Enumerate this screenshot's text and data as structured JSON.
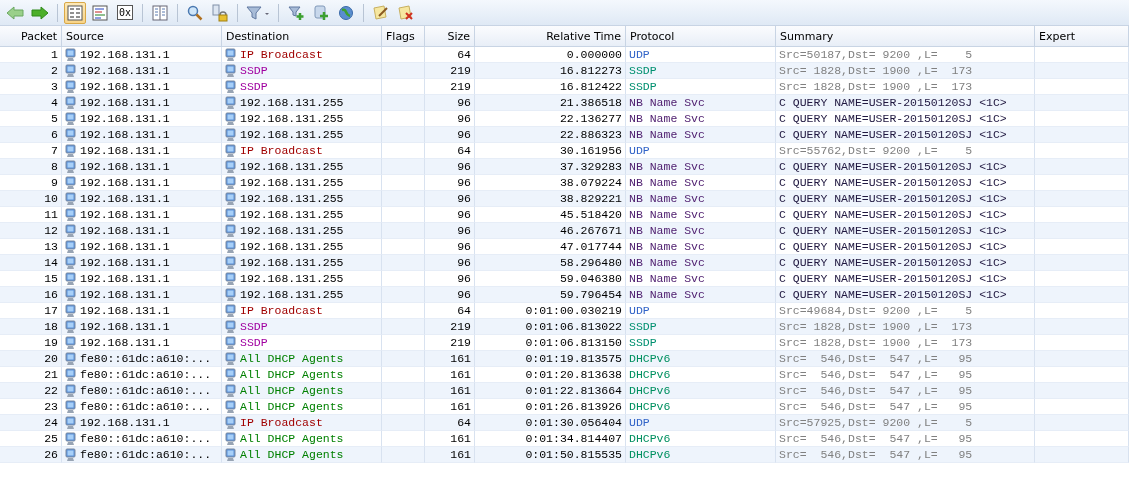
{
  "toolbar": [
    {
      "kind": "back"
    },
    {
      "kind": "forward"
    },
    {
      "kind": "separator"
    },
    {
      "kind": "list-view",
      "selected": true
    },
    {
      "kind": "color-view",
      "selected": false
    },
    {
      "kind": "hex-view",
      "label": "0x",
      "selected": false
    },
    {
      "kind": "separator"
    },
    {
      "kind": "columns"
    },
    {
      "kind": "separator"
    },
    {
      "kind": "search"
    },
    {
      "kind": "lock"
    },
    {
      "kind": "separator"
    },
    {
      "kind": "filter"
    },
    {
      "kind": "separator"
    },
    {
      "kind": "add-filter"
    },
    {
      "kind": "add"
    },
    {
      "kind": "globe"
    },
    {
      "kind": "separator"
    },
    {
      "kind": "edit-note"
    },
    {
      "kind": "delete-note"
    }
  ],
  "table": {
    "columns": [
      "Packet",
      "Source",
      "Destination",
      "Flags",
      "Size",
      "Relative Time",
      "Protocol",
      "Summary",
      "Expert"
    ],
    "rows": [
      {
        "packet": "1",
        "source": "192.168.131.1",
        "destination": {
          "text": "IP Broadcast",
          "color": "#a00000"
        },
        "size": "64",
        "time": "0.000000",
        "protocol": {
          "text": "UDP",
          "color": "#3264c8"
        },
        "summary": {
          "text": "Src=50187,Dst= 9200 ,L=    5",
          "color": "#808080"
        }
      },
      {
        "packet": "2",
        "source": "192.168.131.1",
        "destination": {
          "text": "SSDP",
          "color": "#a000a0"
        },
        "size": "219",
        "time": "16.812273",
        "protocol": {
          "text": "SSDP",
          "color": "#009070"
        },
        "summary": {
          "text": "Src= 1828,Dst= 1900 ,L=  173",
          "color": "#808080"
        }
      },
      {
        "packet": "3",
        "source": "192.168.131.1",
        "destination": {
          "text": "SSDP",
          "color": "#a000a0"
        },
        "size": "219",
        "time": "16.812422",
        "protocol": {
          "text": "SSDP",
          "color": "#009070"
        },
        "summary": {
          "text": "Src= 1828,Dst= 1900 ,L=  173",
          "color": "#808080"
        }
      },
      {
        "packet": "4",
        "source": "192.168.131.1",
        "destination": {
          "text": "192.168.131.255",
          "color": "#000000"
        },
        "size": "96",
        "time": "21.386518",
        "protocol": {
          "text": "NB Name Svc",
          "color": "#502070"
        },
        "summary": {
          "text": "C QUERY NAME=USER-20150120SJ <1C>",
          "color": "#201840"
        }
      },
      {
        "packet": "5",
        "source": "192.168.131.1",
        "destination": {
          "text": "192.168.131.255",
          "color": "#000000"
        },
        "size": "96",
        "time": "22.136277",
        "protocol": {
          "text": "NB Name Svc",
          "color": "#502070"
        },
        "summary": {
          "text": "C QUERY NAME=USER-20150120SJ <1C>",
          "color": "#201840"
        }
      },
      {
        "packet": "6",
        "source": "192.168.131.1",
        "destination": {
          "text": "192.168.131.255",
          "color": "#000000"
        },
        "size": "96",
        "time": "22.886323",
        "protocol": {
          "text": "NB Name Svc",
          "color": "#502070"
        },
        "summary": {
          "text": "C QUERY NAME=USER-20150120SJ <1C>",
          "color": "#201840"
        }
      },
      {
        "packet": "7",
        "source": "192.168.131.1",
        "destination": {
          "text": "IP Broadcast",
          "color": "#a00000"
        },
        "size": "64",
        "time": "30.161956",
        "protocol": {
          "text": "UDP",
          "color": "#3264c8"
        },
        "summary": {
          "text": "Src=55762,Dst= 9200 ,L=    5",
          "color": "#808080"
        }
      },
      {
        "packet": "8",
        "source": "192.168.131.1",
        "destination": {
          "text": "192.168.131.255",
          "color": "#000000"
        },
        "size": "96",
        "time": "37.329283",
        "protocol": {
          "text": "NB Name Svc",
          "color": "#502070"
        },
        "summary": {
          "text": "C QUERY NAME=USER-20150120SJ <1C>",
          "color": "#201840"
        }
      },
      {
        "packet": "9",
        "source": "192.168.131.1",
        "destination": {
          "text": "192.168.131.255",
          "color": "#000000"
        },
        "size": "96",
        "time": "38.079224",
        "protocol": {
          "text": "NB Name Svc",
          "color": "#502070"
        },
        "summary": {
          "text": "C QUERY NAME=USER-20150120SJ <1C>",
          "color": "#201840"
        }
      },
      {
        "packet": "10",
        "source": "192.168.131.1",
        "destination": {
          "text": "192.168.131.255",
          "color": "#000000"
        },
        "size": "96",
        "time": "38.829221",
        "protocol": {
          "text": "NB Name Svc",
          "color": "#502070"
        },
        "summary": {
          "text": "C QUERY NAME=USER-20150120SJ <1C>",
          "color": "#201840"
        }
      },
      {
        "packet": "11",
        "source": "192.168.131.1",
        "destination": {
          "text": "192.168.131.255",
          "color": "#000000"
        },
        "size": "96",
        "time": "45.518420",
        "protocol": {
          "text": "NB Name Svc",
          "color": "#502070"
        },
        "summary": {
          "text": "C QUERY NAME=USER-20150120SJ <1C>",
          "color": "#201840"
        }
      },
      {
        "packet": "12",
        "source": "192.168.131.1",
        "destination": {
          "text": "192.168.131.255",
          "color": "#000000"
        },
        "size": "96",
        "time": "46.267671",
        "protocol": {
          "text": "NB Name Svc",
          "color": "#502070"
        },
        "summary": {
          "text": "C QUERY NAME=USER-20150120SJ <1C>",
          "color": "#201840"
        }
      },
      {
        "packet": "13",
        "source": "192.168.131.1",
        "destination": {
          "text": "192.168.131.255",
          "color": "#000000"
        },
        "size": "96",
        "time": "47.017744",
        "protocol": {
          "text": "NB Name Svc",
          "color": "#502070"
        },
        "summary": {
          "text": "C QUERY NAME=USER-20150120SJ <1C>",
          "color": "#201840"
        }
      },
      {
        "packet": "14",
        "source": "192.168.131.1",
        "destination": {
          "text": "192.168.131.255",
          "color": "#000000"
        },
        "size": "96",
        "time": "58.296480",
        "protocol": {
          "text": "NB Name Svc",
          "color": "#502070"
        },
        "summary": {
          "text": "C QUERY NAME=USER-20150120SJ <1C>",
          "color": "#201840"
        }
      },
      {
        "packet": "15",
        "source": "192.168.131.1",
        "destination": {
          "text": "192.168.131.255",
          "color": "#000000"
        },
        "size": "96",
        "time": "59.046380",
        "protocol": {
          "text": "NB Name Svc",
          "color": "#502070"
        },
        "summary": {
          "text": "C QUERY NAME=USER-20150120SJ <1C>",
          "color": "#201840"
        }
      },
      {
        "packet": "16",
        "source": "192.168.131.1",
        "destination": {
          "text": "192.168.131.255",
          "color": "#000000"
        },
        "size": "96",
        "time": "59.796454",
        "protocol": {
          "text": "NB Name Svc",
          "color": "#502070"
        },
        "summary": {
          "text": "C QUERY NAME=USER-20150120SJ <1C>",
          "color": "#201840"
        }
      },
      {
        "packet": "17",
        "source": "192.168.131.1",
        "destination": {
          "text": "IP Broadcast",
          "color": "#a00000"
        },
        "size": "64",
        "time": "0:01:00.030219",
        "protocol": {
          "text": "UDP",
          "color": "#3264c8"
        },
        "summary": {
          "text": "Src=49684,Dst= 9200 ,L=    5",
          "color": "#808080"
        }
      },
      {
        "packet": "18",
        "source": "192.168.131.1",
        "destination": {
          "text": "SSDP",
          "color": "#a000a0"
        },
        "size": "219",
        "time": "0:01:06.813022",
        "protocol": {
          "text": "SSDP",
          "color": "#009070"
        },
        "summary": {
          "text": "Src= 1828,Dst= 1900 ,L=  173",
          "color": "#808080"
        }
      },
      {
        "packet": "19",
        "source": "192.168.131.1",
        "destination": {
          "text": "SSDP",
          "color": "#a000a0"
        },
        "size": "219",
        "time": "0:01:06.813150",
        "protocol": {
          "text": "SSDP",
          "color": "#009070"
        },
        "summary": {
          "text": "Src= 1828,Dst= 1900 ,L=  173",
          "color": "#808080"
        }
      },
      {
        "packet": "20",
        "source": "fe80::61dc:a610:...",
        "destination": {
          "text": "All DHCP Agents",
          "color": "#008000"
        },
        "size": "161",
        "time": "0:01:19.813575",
        "protocol": {
          "text": "DHCPv6",
          "color": "#009060"
        },
        "summary": {
          "text": "Src=  546,Dst=  547 ,L=   95",
          "color": "#808080"
        }
      },
      {
        "packet": "21",
        "source": "fe80::61dc:a610:...",
        "destination": {
          "text": "All DHCP Agents",
          "color": "#008000"
        },
        "size": "161",
        "time": "0:01:20.813638",
        "protocol": {
          "text": "DHCPv6",
          "color": "#009060"
        },
        "summary": {
          "text": "Src=  546,Dst=  547 ,L=   95",
          "color": "#808080"
        }
      },
      {
        "packet": "22",
        "source": "fe80::61dc:a610:...",
        "destination": {
          "text": "All DHCP Agents",
          "color": "#008000"
        },
        "size": "161",
        "time": "0:01:22.813664",
        "protocol": {
          "text": "DHCPv6",
          "color": "#009060"
        },
        "summary": {
          "text": "Src=  546,Dst=  547 ,L=   95",
          "color": "#808080"
        }
      },
      {
        "packet": "23",
        "source": "fe80::61dc:a610:...",
        "destination": {
          "text": "All DHCP Agents",
          "color": "#008000"
        },
        "size": "161",
        "time": "0:01:26.813926",
        "protocol": {
          "text": "DHCPv6",
          "color": "#009060"
        },
        "summary": {
          "text": "Src=  546,Dst=  547 ,L=   95",
          "color": "#808080"
        }
      },
      {
        "packet": "24",
        "source": "192.168.131.1",
        "destination": {
          "text": "IP Broadcast",
          "color": "#a00000"
        },
        "size": "64",
        "time": "0:01:30.056404",
        "protocol": {
          "text": "UDP",
          "color": "#3264c8"
        },
        "summary": {
          "text": "Src=57925,Dst= 9200 ,L=    5",
          "color": "#808080"
        }
      },
      {
        "packet": "25",
        "source": "fe80::61dc:a610:...",
        "destination": {
          "text": "All DHCP Agents",
          "color": "#008000"
        },
        "size": "161",
        "time": "0:01:34.814407",
        "protocol": {
          "text": "DHCPv6",
          "color": "#009060"
        },
        "summary": {
          "text": "Src=  546,Dst=  547 ,L=   95",
          "color": "#808080"
        }
      },
      {
        "packet": "26",
        "source": "fe80::61dc:a610:...",
        "destination": {
          "text": "All DHCP Agents",
          "color": "#008000"
        },
        "size": "161",
        "time": "0:01:50.815535",
        "protocol": {
          "text": "DHCPv6",
          "color": "#009060"
        },
        "summary": {
          "text": "Src=  546,Dst=  547 ,L=   95",
          "color": "#808080"
        }
      }
    ]
  }
}
